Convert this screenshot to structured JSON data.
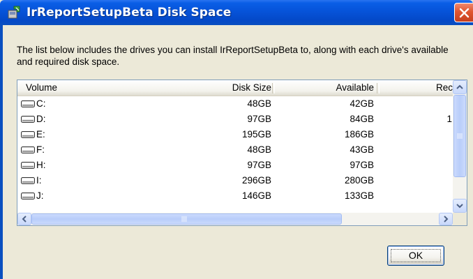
{
  "window": {
    "title": "IrReportSetupBeta Disk Space",
    "title_icon": "setup-box-icon",
    "close_icon": "close-icon",
    "title_bar_color": "#0653d9"
  },
  "description": "The list below includes the drives you can install IrReportSetupBeta to, along with each drive's available and required disk space.",
  "list": {
    "columns": [
      "Volume",
      "Disk Size",
      "Available",
      "Rec"
    ],
    "rows": [
      {
        "volume": "C:",
        "disk_size": "48GB",
        "available": "42GB",
        "required": ""
      },
      {
        "volume": "D:",
        "disk_size": "97GB",
        "available": "84GB",
        "required": "1"
      },
      {
        "volume": "E:",
        "disk_size": "195GB",
        "available": "186GB",
        "required": ""
      },
      {
        "volume": "F:",
        "disk_size": "48GB",
        "available": "43GB",
        "required": ""
      },
      {
        "volume": "H:",
        "disk_size": "97GB",
        "available": "97GB",
        "required": ""
      },
      {
        "volume": "I:",
        "disk_size": "296GB",
        "available": "280GB",
        "required": ""
      },
      {
        "volume": "J:",
        "disk_size": "146GB",
        "available": "133GB",
        "required": ""
      }
    ],
    "row_icon": "hard-drive-icon"
  },
  "buttons": {
    "ok_label": "OK"
  }
}
